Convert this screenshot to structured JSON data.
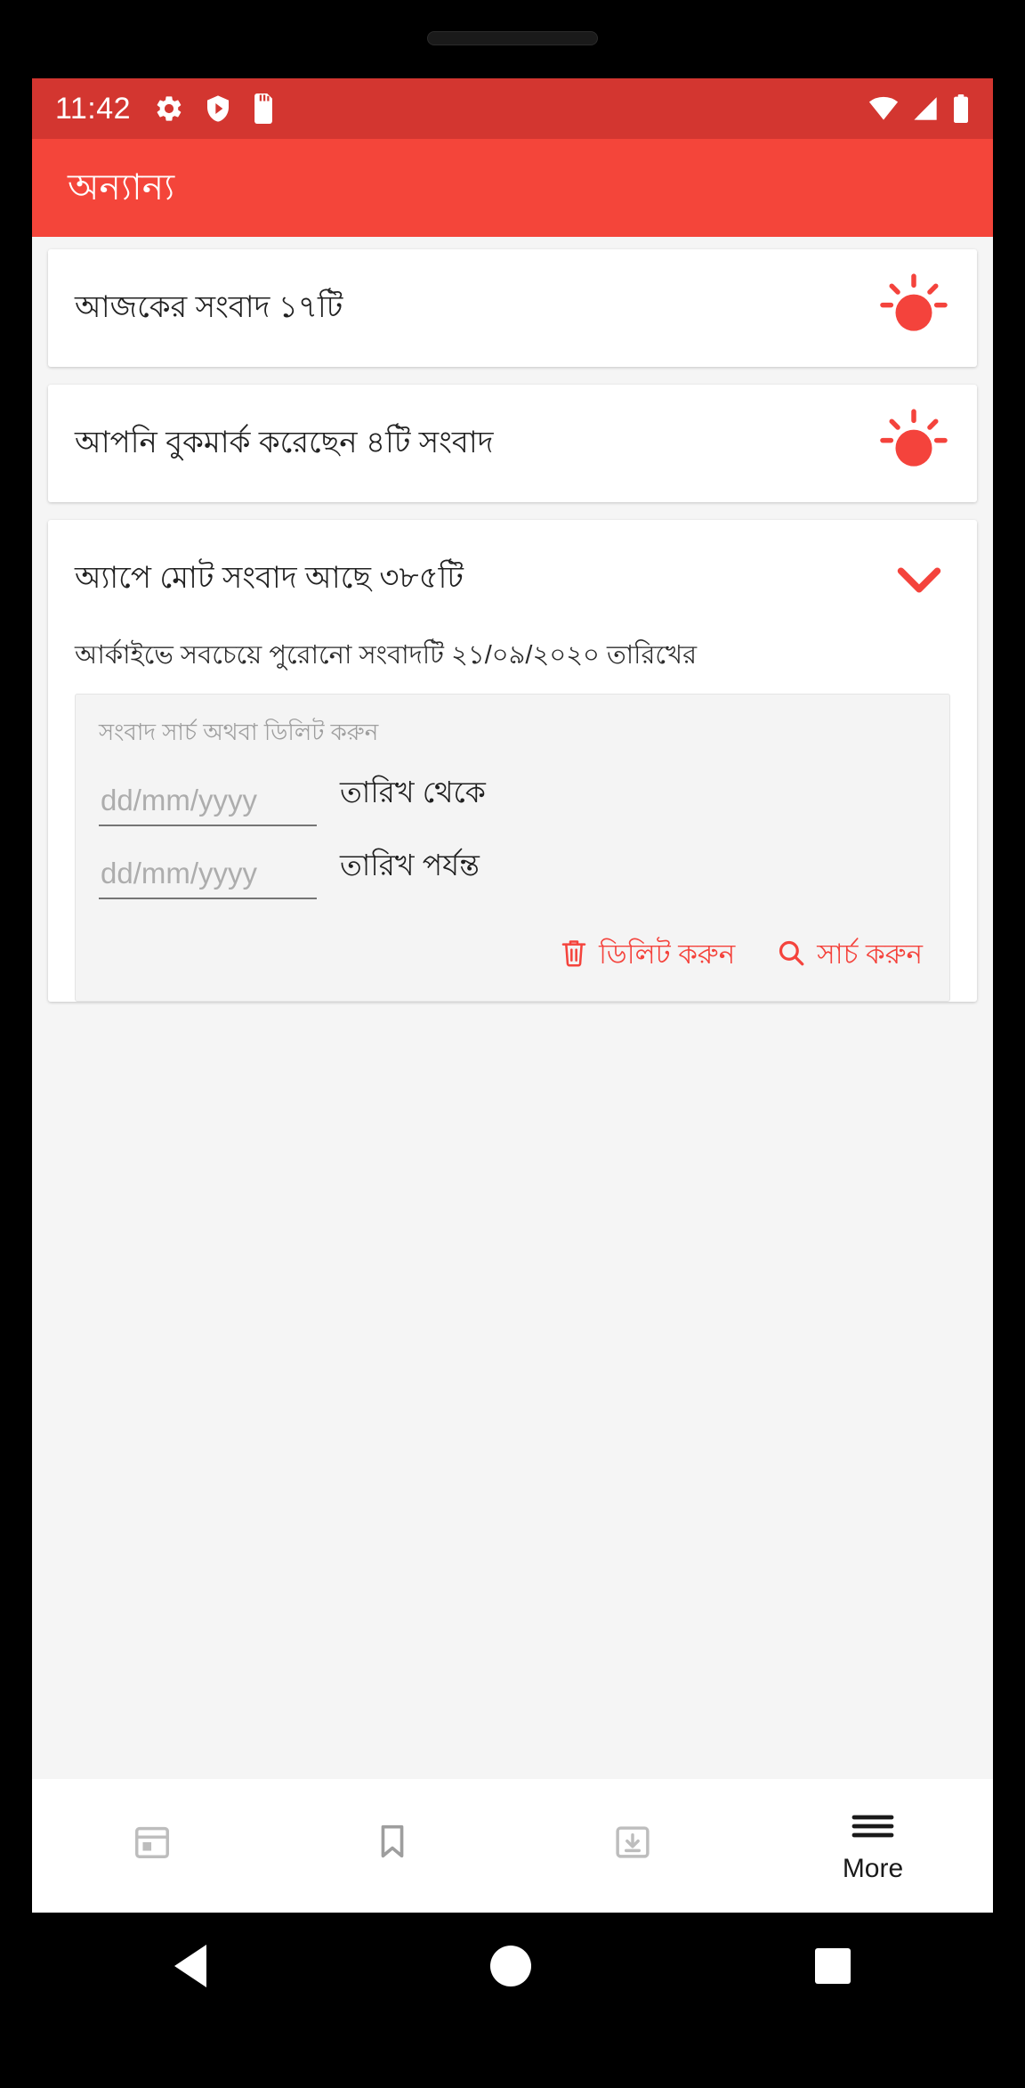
{
  "statusbar": {
    "time": "11:42",
    "left_icons": [
      "gear-icon",
      "play-protect-shield-icon",
      "sd-card-icon"
    ],
    "right_icons": [
      "wifi-icon",
      "cellular-signal-icon",
      "battery-icon"
    ]
  },
  "appbar": {
    "title": "অন্যান্য",
    "background": "#f4453a"
  },
  "cards": {
    "today_news": {
      "text": "আজকের সংবাদ ১৭টি",
      "icon": "sun-icon"
    },
    "bookmarked_news": {
      "text": "আপনি বুকমার্ক করেছেন ৪টি সংবাদ",
      "icon": "sun-icon"
    },
    "total_news": {
      "text": "অ্যাপে মোট সংবাদ আছে ৩৮৫টি",
      "icon": "chevron-down-icon",
      "subtitle": "আর্কাইভে সবচেয়ে পুরোনো সংবাদটি ২১/০৯/২০২০ তারিখের"
    }
  },
  "search_panel": {
    "label": "সংবাদ সার্চ অথবা ডিলিট করুন",
    "from_date": {
      "value": "",
      "placeholder": "dd/mm/yyyy",
      "label": "তারিখ থেকে"
    },
    "to_date": {
      "value": "",
      "placeholder": "dd/mm/yyyy",
      "label": "তারিখ পর্যন্ত"
    },
    "delete_button": "ডিলিট করুন",
    "search_button": "সার্চ করুন",
    "accent_color": "#f4433c"
  },
  "bottom_nav": {
    "items": [
      {
        "label": "",
        "icon": "calendar-icon"
      },
      {
        "label": "",
        "icon": "bookmark-icon"
      },
      {
        "label": "",
        "icon": "archive-download-icon"
      },
      {
        "label": "More",
        "icon": "hamburger-menu-icon"
      }
    ]
  },
  "system_nav": {
    "back": "back-triangle-icon",
    "home": "home-circle-icon",
    "recents": "recents-square-icon"
  }
}
